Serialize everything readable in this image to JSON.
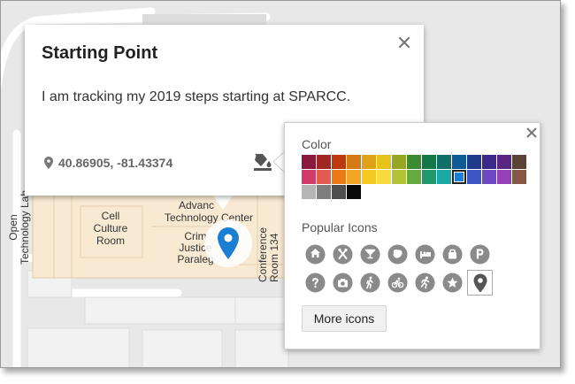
{
  "info_window": {
    "title": "Starting Point",
    "description": "I am tracking my 2019 steps starting at SPARCC.",
    "coordinates": "40.86905, -81.43374"
  },
  "map": {
    "labels": {
      "cell_culture_room": [
        "Cell",
        "Culture",
        "Room"
      ],
      "advanced_tech_center": [
        "Advanc",
        "Technology Center"
      ],
      "criminal_justice": [
        "Crim",
        "Justice",
        "Paraleg"
      ],
      "open_tech_lab": [
        "Open",
        "Technology Lab"
      ],
      "conference_room": [
        "Conference",
        "Room 134"
      ]
    },
    "pin_color": "#1a7fd2"
  },
  "style_popup": {
    "color_label": "Color",
    "icons_label": "Popular Icons",
    "more_icons_label": "More icons",
    "selected_color_index": 25,
    "colors": [
      "#8a1a3b",
      "#a02823",
      "#bd3a10",
      "#d37a12",
      "#e0a317",
      "#e6c21a",
      "#97a524",
      "#3d8a32",
      "#137845",
      "#0f6e67",
      "#0e5a95",
      "#1f3c8c",
      "#3b2a8a",
      "#5a2582",
      "#5c4137",
      "#d23a6a",
      "#e25a52",
      "#ee7a17",
      "#f3a625",
      "#f7c81f",
      "#f6dc3e",
      "#b4c236",
      "#64aa3e",
      "#20996c",
      "#1aa9a5",
      "#1a7fd2",
      "#3a56c3",
      "#6c47c6",
      "#9540b7",
      "#865847",
      "#b5b5b5",
      "#7e7e7e",
      "#4f4f4f",
      "#0a0a0a"
    ],
    "icons": [
      {
        "name": "home-icon"
      },
      {
        "name": "restaurant-icon"
      },
      {
        "name": "bar-icon"
      },
      {
        "name": "cafe-icon"
      },
      {
        "name": "hotel-icon"
      },
      {
        "name": "shopping-icon"
      },
      {
        "name": "parking-icon"
      },
      {
        "name": "help-icon"
      },
      {
        "name": "camera-icon"
      },
      {
        "name": "hiking-icon"
      },
      {
        "name": "cycling-icon"
      },
      {
        "name": "running-icon"
      },
      {
        "name": "star-icon"
      },
      {
        "name": "placemark-icon"
      }
    ],
    "selected_icon_index": 13
  }
}
